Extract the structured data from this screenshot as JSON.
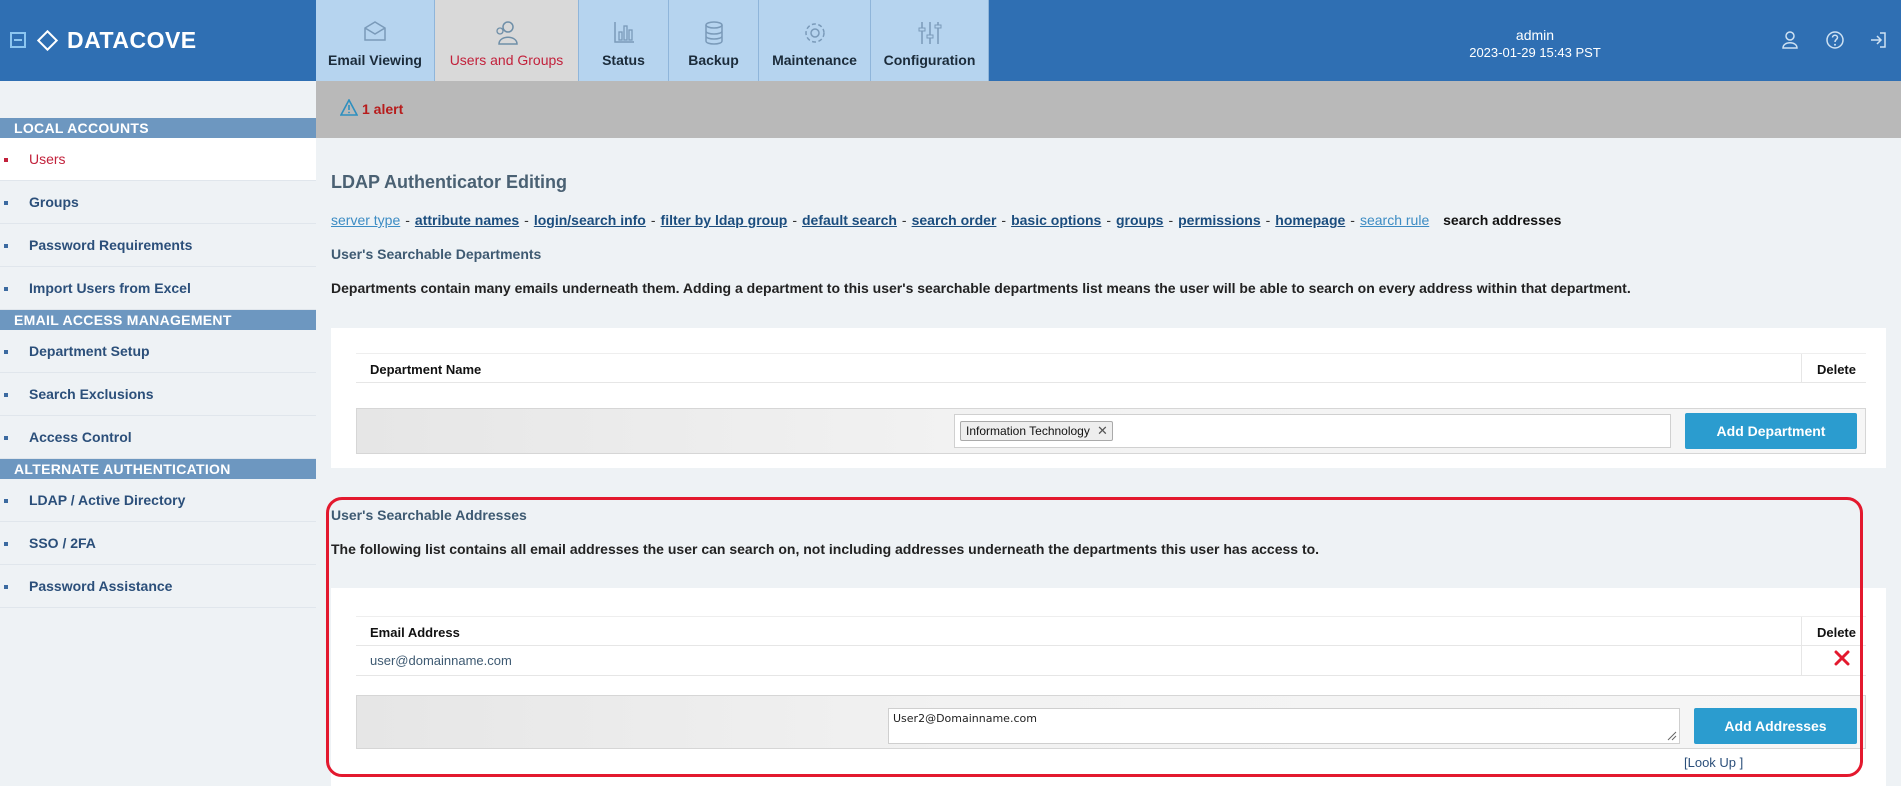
{
  "brand": {
    "name": "DATACOVE"
  },
  "tabs": [
    {
      "label": "Email Viewing",
      "icon": "envelope-icon"
    },
    {
      "label": "Users and Groups",
      "icon": "users-icon",
      "active": true
    },
    {
      "label": "Status",
      "icon": "bar-chart-icon"
    },
    {
      "label": "Backup",
      "icon": "database-icon"
    },
    {
      "label": "Maintenance",
      "icon": "gear-icon"
    },
    {
      "label": "Configuration",
      "icon": "sliders-icon"
    }
  ],
  "user": {
    "name": "admin",
    "datetime": "2023-01-29 15:43 PST"
  },
  "header_icons": [
    "user-profile-icon",
    "help-icon",
    "logout-icon"
  ],
  "sidebar": {
    "sections": [
      {
        "title": "LOCAL ACCOUNTS",
        "items": [
          "Users",
          "Groups",
          "Password Requirements",
          "Import Users from Excel"
        ]
      },
      {
        "title": "EMAIL ACCESS MANAGEMENT",
        "items": [
          "Department Setup",
          "Search Exclusions",
          "Access Control"
        ]
      },
      {
        "title": "ALTERNATE AUTHENTICATION",
        "items": [
          "LDAP / Active Directory",
          "SSO / 2FA",
          "Password Assistance"
        ]
      }
    ],
    "active_item": "Users"
  },
  "alert": {
    "text": "1 alert"
  },
  "page": {
    "title": "LDAP Authenticator Editing",
    "breadcrumbs": [
      {
        "label": "server type",
        "style": "muted"
      },
      {
        "label": "attribute names",
        "style": "link"
      },
      {
        "label": "login/search info",
        "style": "link"
      },
      {
        "label": "filter by ldap group",
        "style": "link"
      },
      {
        "label": "default search",
        "style": "link"
      },
      {
        "label": "search order",
        "style": "link"
      },
      {
        "label": "basic options",
        "style": "link"
      },
      {
        "label": "groups",
        "style": "link"
      },
      {
        "label": "permissions",
        "style": "link"
      },
      {
        "label": "homepage",
        "style": "link"
      },
      {
        "label": "search rule",
        "style": "muted"
      },
      {
        "label": "search addresses",
        "style": "current"
      }
    ],
    "departments": {
      "heading": "User's Searchable Departments",
      "description": "Departments contain many emails underneath them. Adding a department to this user's searchable departments list means the user will be able to search on every address within that department.",
      "col_name": "Department Name",
      "col_delete": "Delete",
      "selected_tag": "Information Technology",
      "add_button": "Add Department"
    },
    "addresses": {
      "heading": "User's Searchable Addresses",
      "description": "The following list contains all email addresses the user can search on, not including addresses underneath the departments this user has access to.",
      "col_name": "Email Address",
      "col_delete": "Delete",
      "rows": [
        "user@domainname.com"
      ],
      "input_value": "User2@Domainname.com",
      "add_button": "Add Addresses",
      "lookup_label": "[Look Up ]"
    }
  },
  "colors": {
    "header": "#2f6fb3",
    "tab": "#b6d4ef",
    "active_text": "#c2213b",
    "button": "#2b9ccf",
    "section": "#6d97c0",
    "highlight": "#e3192e"
  }
}
